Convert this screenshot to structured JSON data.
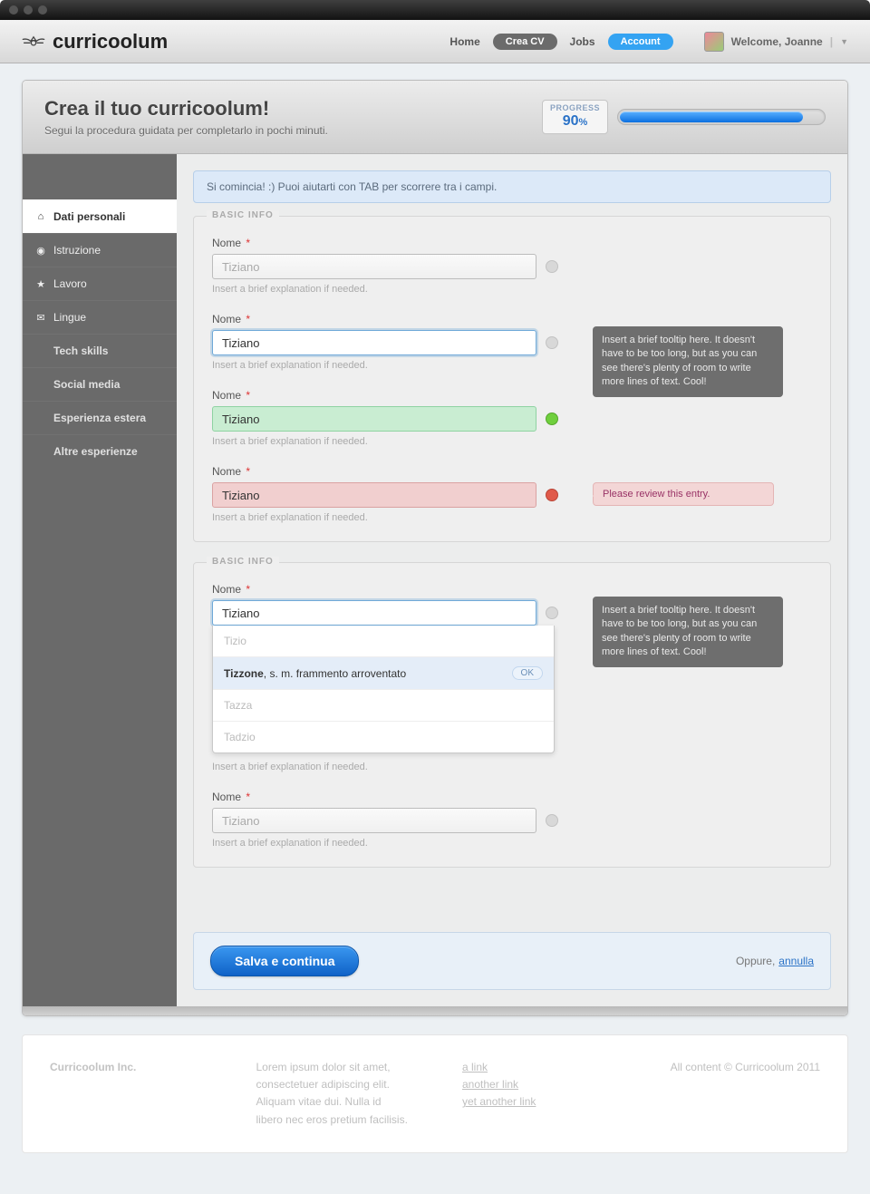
{
  "brand": "curricoolum",
  "nav": {
    "home": "Home",
    "crea": "Crea CV",
    "jobs": "Jobs",
    "account": "Account"
  },
  "user": {
    "welcome": "Welcome, Joanne"
  },
  "header": {
    "title": "Crea il tuo curricoolum!",
    "subtitle": "Segui la procedura guidata per completarlo in pochi minuti."
  },
  "progress": {
    "label": "PROGRESS",
    "value": "90",
    "pct": "%"
  },
  "alert": "Si comincia! :) Puoi aiutarti con TAB per scorrere tra i campi.",
  "sidebar": {
    "items": [
      "Dati personali",
      "Istruzione",
      "Lavoro",
      "Lingue",
      "Tech skills",
      "Social media",
      "Esperienza estera",
      "Altre esperienze"
    ]
  },
  "legend": "BASIC INFO",
  "field": {
    "label": "Nome",
    "req": "*",
    "placeholder": "Tiziano",
    "value": "Tiziano",
    "hint": "Insert a brief explanation if needed."
  },
  "tooltip": "Insert a brief tooltip here. It doesn't have to be too long, but as you can see there's plenty of room to write more lines of text. Cool!",
  "errtip": "Please review this entry.",
  "ac": {
    "items": [
      {
        "t": "Tizio"
      },
      {
        "b": "Tizzone",
        "t": ", s. m. frammento arroventato",
        "sel": true
      },
      {
        "t": "Tazza"
      },
      {
        "t": "Tadzio"
      }
    ],
    "ok": "OK"
  },
  "actions": {
    "save": "Salva e continua",
    "or": "Oppure,",
    "cancel": "annulla"
  },
  "footer": {
    "company": "Curricoolum Inc.",
    "lorem": "Lorem ipsum dolor sit amet, consectetuer adipiscing elit. Aliquam vitae dui. Nulla id libero nec eros pretium facilisis.",
    "links": [
      "a link",
      "another link",
      "yet another link"
    ],
    "copy": "All content © Curricoolum 2011"
  }
}
